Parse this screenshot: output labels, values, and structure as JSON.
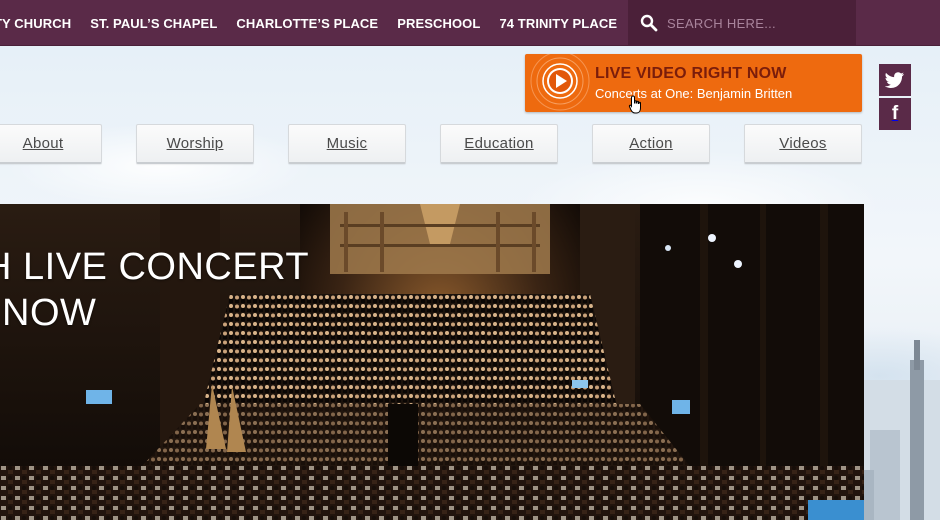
{
  "topnav": {
    "items": [
      {
        "label": "TY CHURCH"
      },
      {
        "label": "ST. PAUL’S CHAPEL"
      },
      {
        "label": "CHARLOTTE’S PLACE"
      },
      {
        "label": "PRESCHOOL"
      },
      {
        "label": "74 TRINITY PLACE"
      }
    ]
  },
  "search": {
    "placeholder": "SEARCH HERE...",
    "icon": "search-icon"
  },
  "live": {
    "title": "LIVE VIDEO RIGHT NOW",
    "subtitle": "Concerts at One: Benjamin Britten",
    "icon": "play-icon",
    "color": "#ee6a0f"
  },
  "social": {
    "twitter_icon": "twitter-icon",
    "facebook_icon": "facebook-icon",
    "facebook_glyph": "f"
  },
  "mainnav": {
    "items": [
      {
        "label": "About"
      },
      {
        "label": "Worship"
      },
      {
        "label": "Music"
      },
      {
        "label": "Education"
      },
      {
        "label": "Action"
      },
      {
        "label": "Videos"
      }
    ]
  },
  "hero": {
    "line1": "H LIVE CONCERT",
    "line2": "NOW"
  },
  "colors": {
    "brand": "#5a2a48",
    "accent": "#ee6a0f"
  }
}
